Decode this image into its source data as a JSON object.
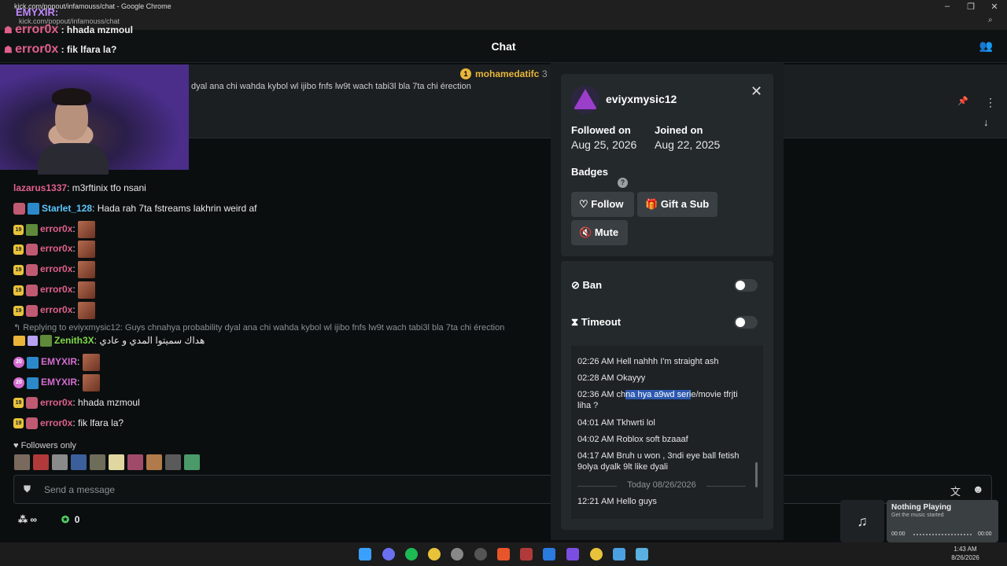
{
  "window": {
    "title": "kick.com/popout/infamouss/chat - Google Chrome",
    "url": "kick.com/popout/infamouss/chat"
  },
  "overlay": {
    "top_user": "EMYXIR:",
    "lines": [
      {
        "user": "error0x",
        "text": " : hhada mzmoul"
      },
      {
        "user": "error0x",
        "text": " : fik lfara la?"
      }
    ]
  },
  "header": {
    "title": "Chat"
  },
  "pinned": {
    "user": "mohamedatifc",
    "count": "3",
    "badge": "1",
    "text": "dyal ana chi wahda kybol wl ijibo fnfs lw9t wach tabi3l bla 7ta chi érection"
  },
  "messages": [
    {
      "user": "lazarus1337",
      "text": " m3rftinix tfo nsani"
    },
    {
      "user": "Starlet_128",
      "text": " Hada rah 7ta fstreams lakhrin weird af"
    },
    {
      "user": "error0x",
      "badge": "19",
      "text": ""
    },
    {
      "user": "error0x",
      "badge": "19",
      "text": ""
    },
    {
      "user": "error0x",
      "badge": "19",
      "text": ""
    },
    {
      "user": "error0x",
      "badge": "19",
      "text": ""
    },
    {
      "user": "error0x",
      "badge": "19",
      "text": ""
    },
    {
      "user": "Zenith3X",
      "text": " هداك سميتوا المدي و عادي"
    },
    {
      "user": "EMYXIR",
      "badge": "20",
      "text": ""
    },
    {
      "user": "EMYXIR",
      "badge": "20",
      "text": ""
    },
    {
      "user": "error0x",
      "badge": "19",
      "text": " hhada mzmoul"
    },
    {
      "user": "error0x",
      "badge": "19",
      "text": " fik lfara la?"
    }
  ],
  "reply": "Replying to eviyxmysic12: Guys chnahya probability dyal ana chi wahda kybol wl ijibo fnfs lw9t wach tabi3l bla 7ta chi érection",
  "followers_only": "Followers only",
  "input": {
    "placeholder": "Send a message"
  },
  "footer": {
    "left": "∞",
    "points": "0"
  },
  "user_card": {
    "username": "eviyxmysic12",
    "followed_label": "Followed on",
    "followed_value": "Aug 25, 2026",
    "joined_label": "Joined on",
    "joined_value": "Aug 22, 2025",
    "badges_label": "Badges",
    "follow_btn": "Follow",
    "gift_btn": "Gift a Sub",
    "mute_btn": "Mute",
    "ban_label": "Ban",
    "timeout_label": "Timeout",
    "history": [
      {
        "time": "02:26 AM",
        "text": "Hell nahhh I'm straight ash"
      },
      {
        "time": "02:28 AM",
        "text": "Okayyy"
      },
      {
        "time": "02:36 AM",
        "pre": "ch",
        "hl": "na hya a9wd seri",
        "post": "e/movie tfrjti liha ?"
      },
      {
        "time": "04:01 AM",
        "text": "Tkhwrti lol"
      },
      {
        "time": "04:02 AM",
        "text": "Roblox soft bzaaaf"
      },
      {
        "time": "04:17 AM",
        "text": "Bruh u won , 3ndi eye ball fetish 9olya dyalk 9lt like dyali"
      },
      {
        "time": "12:21 AM",
        "text": "Hello guys"
      }
    ],
    "separator": "Today 08/26/2026"
  },
  "music": {
    "title": "Nothing Playing",
    "subtitle": "Get the music started",
    "start": "00:00",
    "end": "00:00"
  },
  "taskbar": {
    "time": "1:43 AM",
    "date": "8/26/2026"
  }
}
